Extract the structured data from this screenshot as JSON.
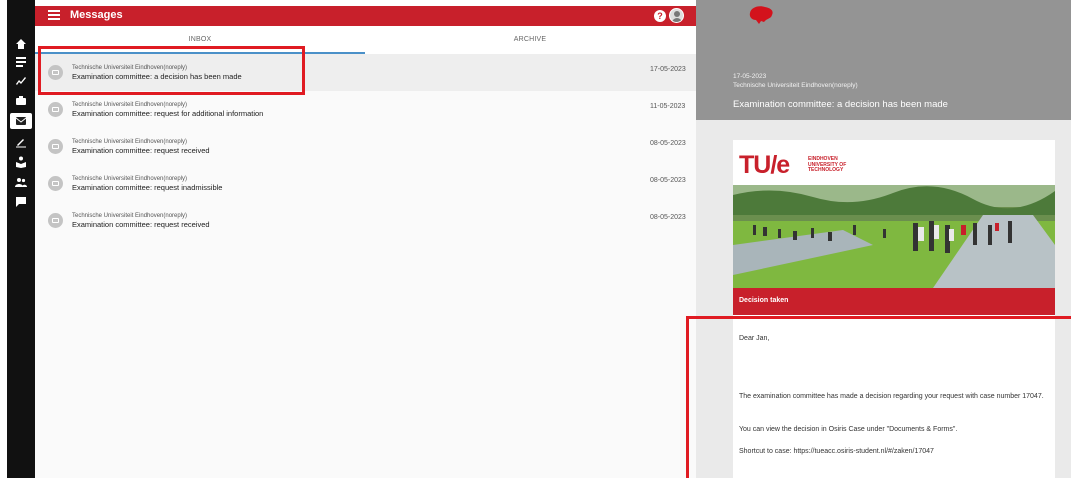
{
  "app": {
    "title": "Messages"
  },
  "rail": {
    "icons": [
      "home-icon",
      "list-icon",
      "trending-icon",
      "briefcase-icon",
      "mail-icon",
      "edit-icon",
      "person-reading-icon",
      "people-icon",
      "chat-icon"
    ],
    "active": "mail-icon"
  },
  "header": {
    "help_icon": "help-icon",
    "help_glyph": "?",
    "avatar": "avatar"
  },
  "tabs": [
    {
      "label": "INBOX",
      "active": true
    },
    {
      "label": "ARCHIVE",
      "active": false
    }
  ],
  "messages": [
    {
      "sender": "Technische Universiteit Eindhoven(noreply)",
      "subject": "Examination committee: a decision has been made",
      "date": "17-05-2023",
      "selected": true
    },
    {
      "sender": "Technische Universiteit Eindhoven(noreply)",
      "subject": "Examination committee: request for additional information",
      "date": "11-05-2023",
      "selected": false
    },
    {
      "sender": "Technische Universiteit Eindhoven(noreply)",
      "subject": "Examination committee: request received",
      "date": "08-05-2023",
      "selected": false
    },
    {
      "sender": "Technische Universiteit Eindhoven(noreply)",
      "subject": "Examination committee: request inadmissible",
      "date": "08-05-2023",
      "selected": false
    },
    {
      "sender": "Technische Universiteit Eindhoven(noreply)",
      "subject": "Examination committee: request received",
      "date": "08-05-2023",
      "selected": false
    }
  ],
  "reader": {
    "date": "17-05-2023",
    "sender": "Technische Universiteit Eindhoven(noreply)",
    "subject": "Examination committee: a decision has been made",
    "logo_mark": "TU/e",
    "logo_line1": "EINDHOVEN",
    "logo_line2": "UNIVERSITY OF",
    "logo_line3": "TECHNOLOGY",
    "banner": "Decision taken",
    "greeting": "Dear Jan,",
    "para1": "The examination committee has made a decision regarding your request with case number 17047.",
    "para2": "You can view the decision in Osiris Case under \"Documents & Forms\".",
    "para3": "Shortcut to case: https://tueacc.osiris-student.nl/#/zaken/17047"
  },
  "colors": {
    "brand_red": "#c8202b",
    "highlight_red": "#e01b22",
    "tab_underline": "#4a90c8"
  }
}
